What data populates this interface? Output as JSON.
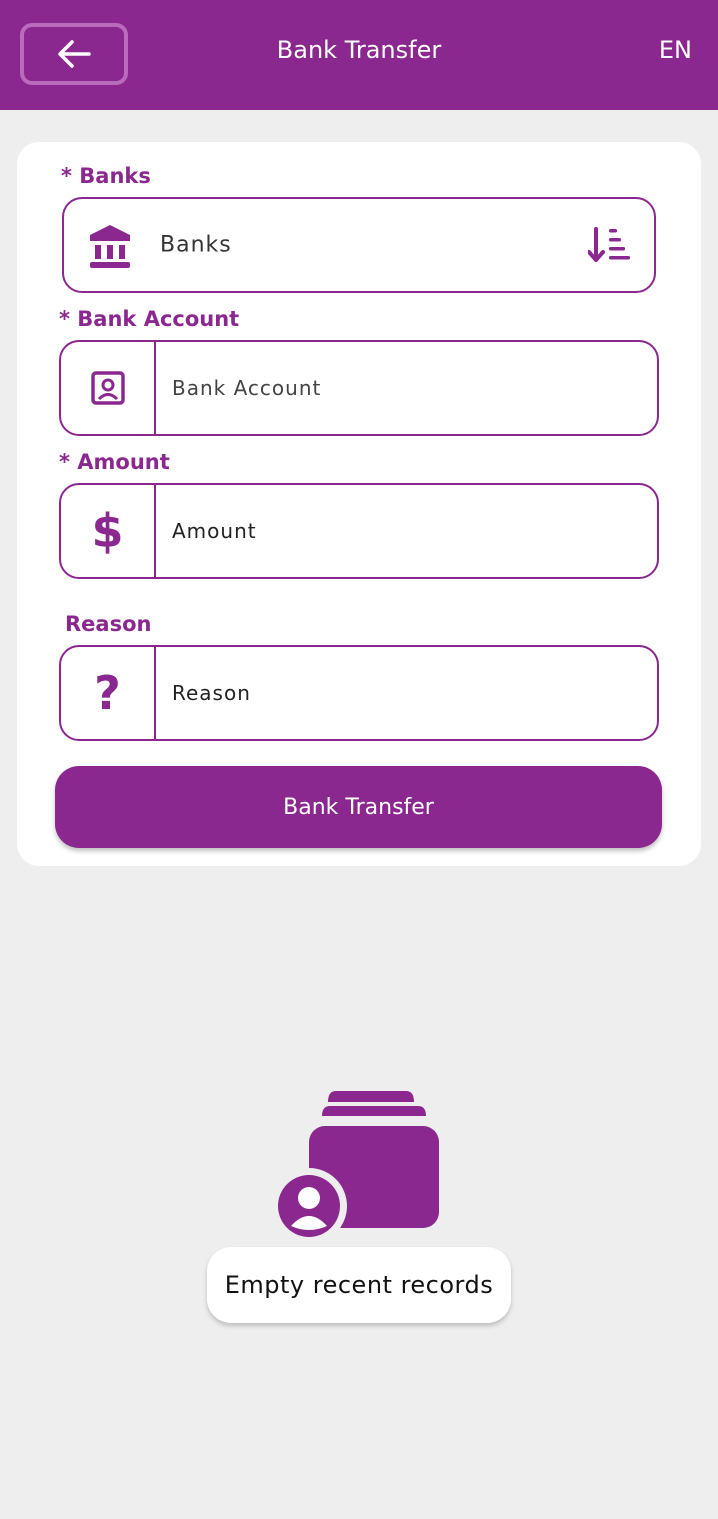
{
  "header": {
    "title": "Bank Transfer",
    "language": "EN",
    "back_icon": "arrow-left-icon"
  },
  "form": {
    "banks": {
      "label": "* Banks",
      "value": "Banks",
      "icon": "bank-icon",
      "sort_icon": "sort-descending-icon"
    },
    "bank_account": {
      "label": "* Bank Account",
      "placeholder": "Bank Account",
      "icon": "account-box-icon"
    },
    "amount": {
      "label": "* Amount",
      "placeholder": "Amount",
      "icon": "dollar-icon"
    },
    "reason": {
      "label": "Reason",
      "placeholder": "Reason",
      "icon": "question-mark-icon"
    },
    "submit_label": "Bank Transfer"
  },
  "empty_state": {
    "message": "Empty recent records",
    "icon": "empty-records-icon"
  },
  "colors": {
    "brand": "#8b288f",
    "background": "#eeeeee"
  }
}
